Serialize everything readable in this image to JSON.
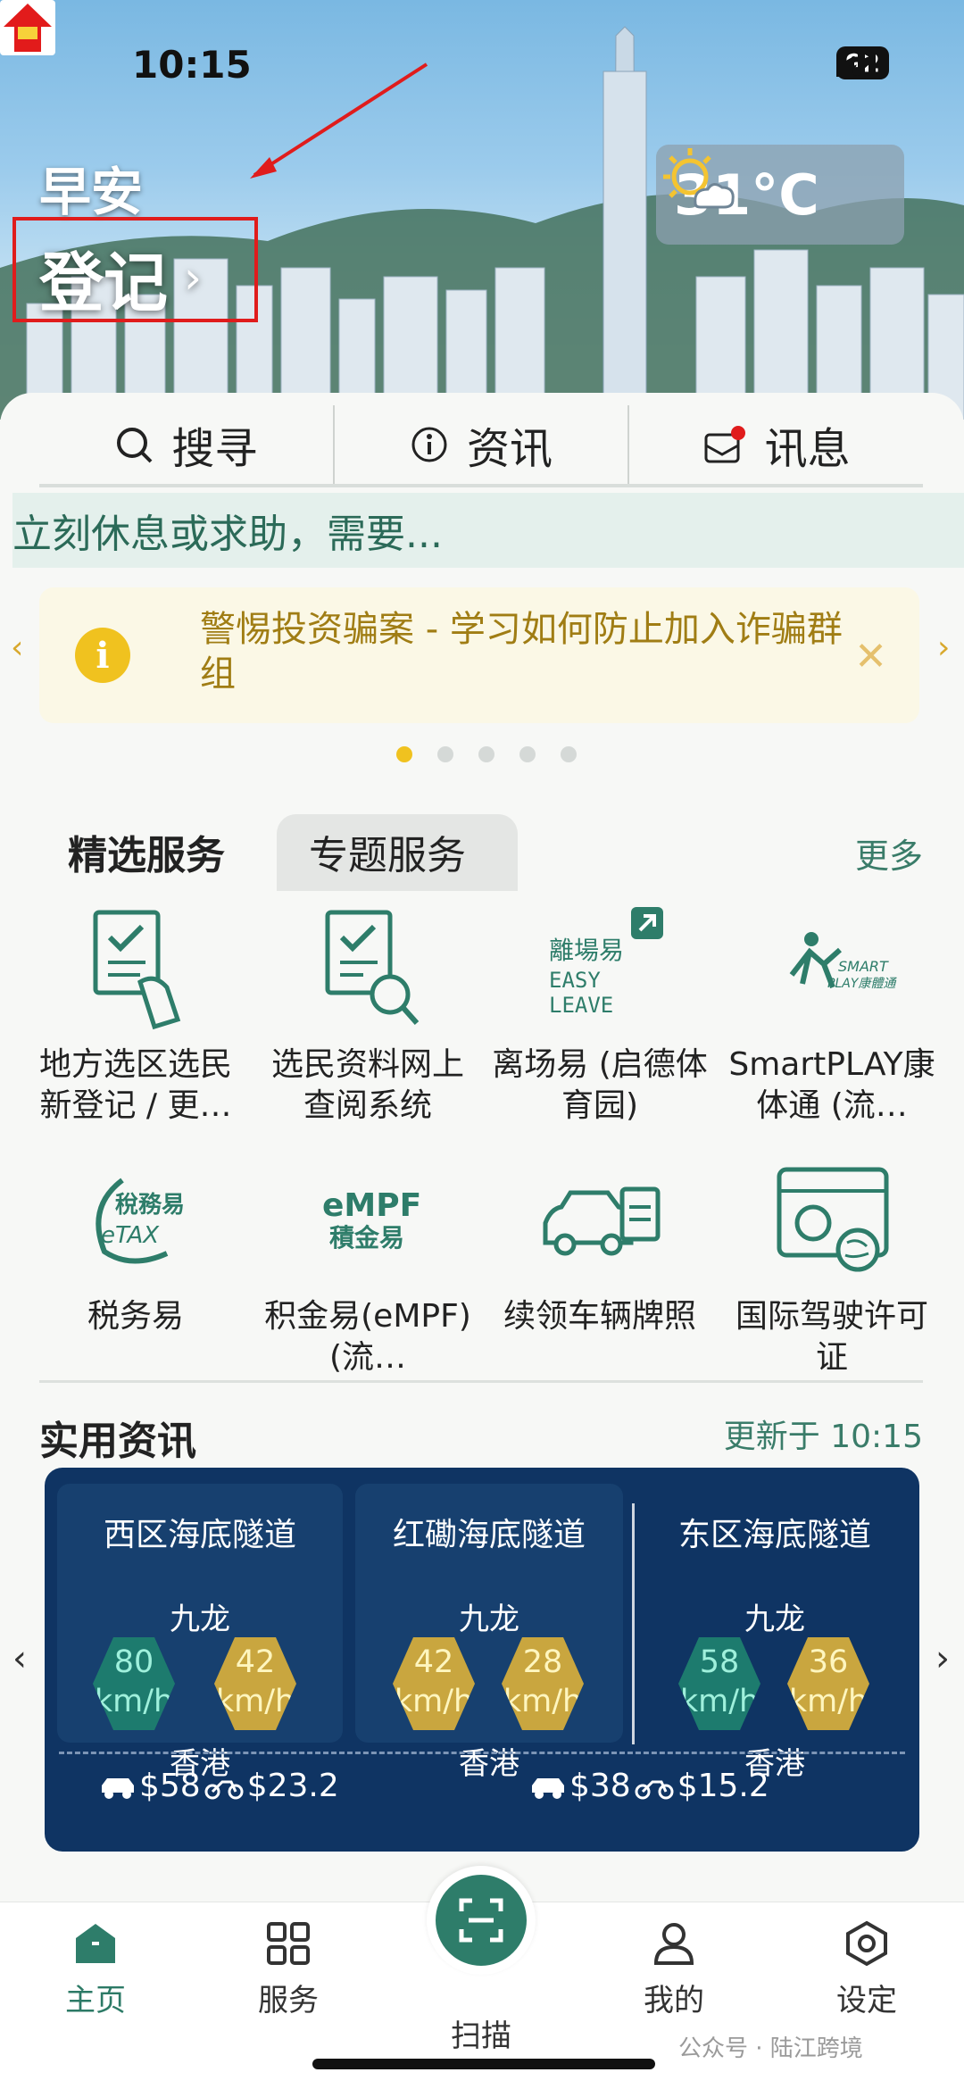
{
  "status_bar": {
    "time": "10:15",
    "battery": "92"
  },
  "header": {
    "greeting": "早安",
    "login_label": "登记",
    "login_chevron": "›",
    "weather_temp": "31°C",
    "weather_icon": "sun-cloud-icon",
    "hot_badge_icon": "very-hot-warning-icon"
  },
  "tabs": [
    {
      "label": "搜寻",
      "icon": "search-icon"
    },
    {
      "label": "资讯",
      "icon": "info-icon"
    },
    {
      "label": "讯息",
      "icon": "message-icon"
    }
  ],
  "ticker_text": "立刻休息或求助，需要...",
  "notice": {
    "text": "警惕投资骗案 - 学习如何防止加入诈骗群组",
    "icon_glyph": "i",
    "close_glyph": "✕"
  },
  "carousel": {
    "count": 5,
    "active_index": 0
  },
  "services": {
    "active_tab": "精选服务",
    "other_tab": "专题服务",
    "more_label": "更多",
    "items": [
      {
        "label": "地方选区选民新登记 / 更…",
        "icon": "voter-register-icon"
      },
      {
        "label": "选民资料网上查阅系统",
        "icon": "voter-search-icon"
      },
      {
        "label": "离场易 (启德体育园)",
        "icon": "easy-leave-icon",
        "icon_text": "離場易 EASY LEAVE"
      },
      {
        "label": "SmartPLAY康体通 (流…",
        "icon": "smartplay-icon",
        "icon_text": "SMART PLAY 康體通"
      },
      {
        "label": "税务易",
        "icon": "etax-icon",
        "icon_text": "稅務易 eTAX"
      },
      {
        "label": "积金易(eMPF) (流…",
        "icon": "empf-icon",
        "icon_text": "eMPF 積金易"
      },
      {
        "label": "续领车辆牌照",
        "icon": "vehicle-licence-icon"
      },
      {
        "label": "国际驾驶许可证",
        "icon": "driving-permit-icon"
      }
    ]
  },
  "practical_info": {
    "title": "实用资讯",
    "updated": "更新于 10:15",
    "tunnels": [
      {
        "name": "西区海底隧道",
        "top": "九龙",
        "bottom": "香港",
        "speed_a": "80",
        "speed_b": "42",
        "unit": "km/h"
      },
      {
        "name": "红磡海底隧道",
        "top": "九龙",
        "bottom": "香港",
        "speed_a": "42",
        "speed_b": "28",
        "unit": "km/h"
      },
      {
        "name": "东区海底隧道",
        "top": "九龙",
        "bottom": "香港",
        "speed_a": "58",
        "speed_b": "36",
        "unit": "km/h"
      }
    ],
    "tolls": [
      {
        "car": "$58",
        "bike": "$23.2"
      },
      {
        "car": "$38",
        "bike": "$15.2"
      }
    ],
    "prev_glyph": "‹",
    "next_glyph": "›"
  },
  "bottom_nav": [
    {
      "label": "主页",
      "icon": "home-icon"
    },
    {
      "label": "服务",
      "icon": "grid-icon"
    },
    {
      "label": "扫描",
      "icon": "scan-icon"
    },
    {
      "label": "我的",
      "icon": "profile-icon"
    },
    {
      "label": "设定",
      "icon": "settings-icon"
    }
  ],
  "watermark": "公众号 · 陆江跨境",
  "colors": {
    "brand_green": "#2e7d6a",
    "tunnel_bg": "#0f3463",
    "annotation_red": "#e01c1c",
    "notice_text": "#a07d14"
  }
}
